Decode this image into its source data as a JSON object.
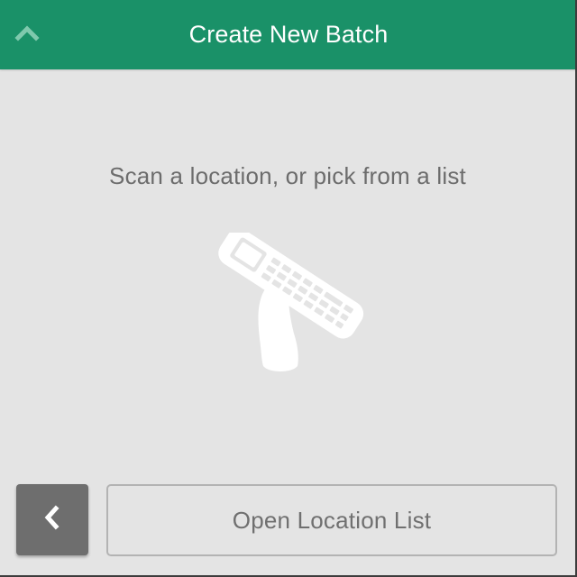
{
  "header": {
    "title": "Create New Batch",
    "collapse_icon": "chevron-up-icon",
    "background_color": "#1a9168"
  },
  "main": {
    "instruction": "Scan a location, or pick from a list",
    "illustration_icon": "handheld-scanner-icon",
    "background_color": "#e4e4e4"
  },
  "footer": {
    "back_icon": "chevron-left-icon",
    "open_location_list_label": "Open Location List"
  }
}
